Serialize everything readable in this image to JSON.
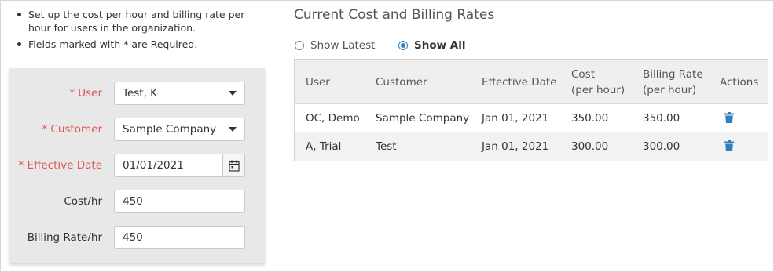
{
  "instructions": [
    "Set up the cost per hour and billing rate per hour for users in the organization.",
    "Fields marked with * are Required."
  ],
  "form": {
    "user": {
      "label": "* User",
      "value": "Test, K"
    },
    "customer": {
      "label": "* Customer",
      "value": "Sample Company"
    },
    "effective_date": {
      "label": "* Effective Date",
      "value": "01/01/2021"
    },
    "cost": {
      "label": "Cost/hr",
      "value": "450"
    },
    "billing_rate": {
      "label": "Billing Rate/hr",
      "value": "450"
    }
  },
  "rates": {
    "title": "Current Cost and Billing Rates",
    "filter": {
      "show_latest": "Show Latest",
      "show_all": "Show All",
      "selected": "show_all"
    },
    "columns": {
      "user": "User",
      "customer": "Customer",
      "effective_date": "Effective Date",
      "cost_line1": "Cost",
      "cost_line2": "(per hour)",
      "billing_line1": "Billing Rate",
      "billing_line2": "(per hour)",
      "actions": "Actions"
    },
    "rows": [
      {
        "user": "OC, Demo",
        "customer": "Sample Company",
        "effective_date": "Jan 01, 2021",
        "cost": "350.00",
        "billing_rate": "350.00",
        "action_icon": "trash-icon"
      },
      {
        "user": "A, Trial",
        "customer": "Test",
        "effective_date": "Jan 01, 2021",
        "cost": "300.00",
        "billing_rate": "300.00",
        "action_icon": "trash-icon"
      }
    ]
  },
  "colors": {
    "required": "#e05555",
    "accent": "#2f7fc1",
    "panel": "#e8e8e8"
  }
}
